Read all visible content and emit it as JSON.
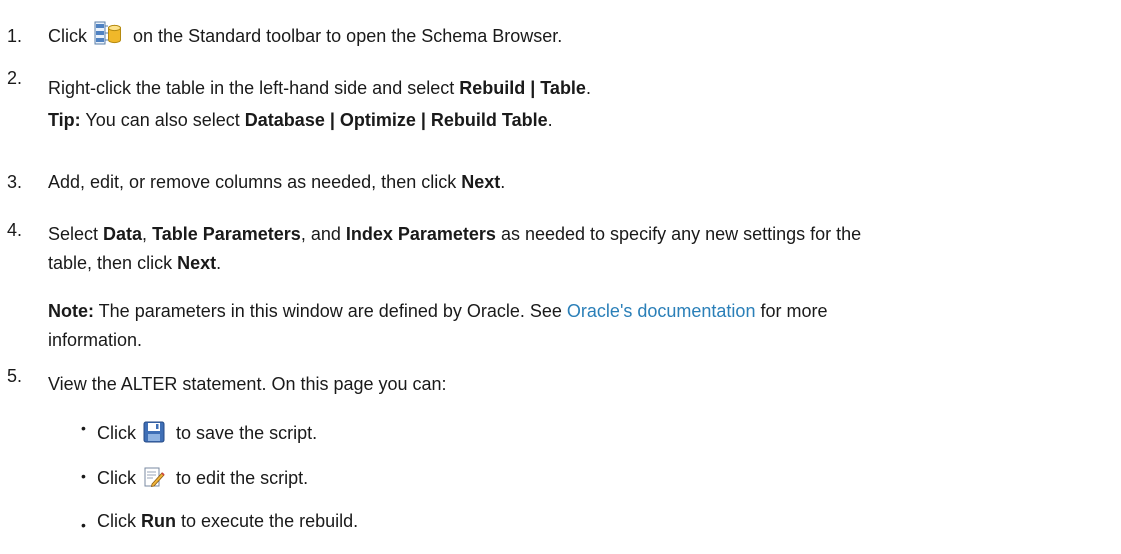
{
  "steps": [
    {
      "num": "1.",
      "click": "Click",
      "icon": "schema-browser-icon",
      "rest": "on the Standard toolbar to open the Schema Browser."
    },
    {
      "num": "2.",
      "pre": "Right-click the table in the left-hand side and select ",
      "bold": "Rebuild | Table",
      "post": ".",
      "tip_label": "Tip:",
      "tip_pre": " You can also select ",
      "tip_bold": "Database | Optimize | Rebuild Table",
      "tip_post": "."
    },
    {
      "num": "3.",
      "pre": "Add, edit, or remove columns as needed, then click ",
      "bold": "Next",
      "post": "."
    },
    {
      "num": "4.",
      "t1": "Select ",
      "b1": "Data",
      "t2": ", ",
      "b2": "Table Parameters",
      "t3": ", and ",
      "b3": "Index Parameters",
      "t4": " as needed to specify any new settings for the",
      "t5": "table, then click ",
      "b4": "Next",
      "t6": ".",
      "note_label": "Note:",
      "note_pre": " The parameters in this window are defined by Oracle. See ",
      "note_link": "Oracle's documentation",
      "note_post": " for more",
      "note_line2": "information."
    },
    {
      "num": "5.",
      "text": "View the ALTER statement. On this page you can:",
      "bullets": [
        {
          "bullet": "•",
          "click": "Click",
          "icon": "save-icon",
          "rest": "to save the script."
        },
        {
          "bullet": "•",
          "click": "Click",
          "icon": "edit-script-icon",
          "rest": "to edit the script."
        },
        {
          "bullet": "•",
          "pre": "Click ",
          "bold": "Run",
          "post": " to execute the rebuild."
        }
      ]
    }
  ],
  "colors": {
    "text": "#1a1a1a",
    "link": "#2a7fb8"
  }
}
